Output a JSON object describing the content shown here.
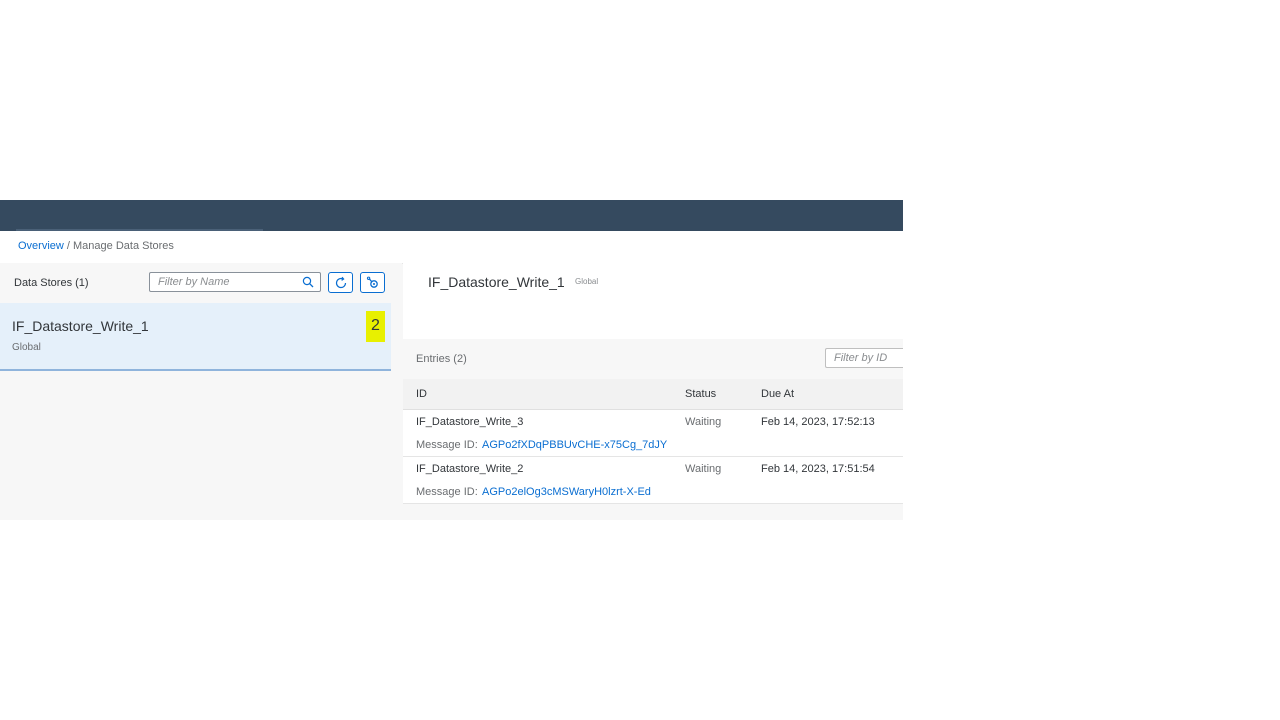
{
  "breadcrumb": {
    "link": "Overview",
    "separator": " / ",
    "current": "Manage Data Stores"
  },
  "master": {
    "title": "Data Stores (1)",
    "search_placeholder": "Filter by Name",
    "search_icon": "search-icon",
    "refresh_icon": "refresh-icon",
    "settings_icon": "gear-icon",
    "items": [
      {
        "name": "IF_Datastore_Write_1",
        "scope": "Global",
        "count": "2"
      }
    ]
  },
  "detail": {
    "title": "IF_Datastore_Write_1",
    "scope": "Global",
    "entries_title": "Entries (2)",
    "filter_placeholder": "Filter by ID",
    "columns": {
      "id": "ID",
      "status": "Status",
      "due": "Due At"
    },
    "message_label": "Message ID:",
    "rows": [
      {
        "id": "IF_Datastore_Write_3",
        "status": "Waiting",
        "due": "Feb 14, 2023, 17:52:13",
        "message_id": "AGPo2fXDqPBBUvCHE-x75Cg_7dJY"
      },
      {
        "id": "IF_Datastore_Write_2",
        "status": "Waiting",
        "due": "Feb 14, 2023, 17:51:54",
        "message_id": "AGPo2elOg3cMSWaryH0lzrt-X-Ed"
      }
    ]
  },
  "colors": {
    "shell": "#354a5f",
    "link": "#0a6ed1",
    "selected": "#e5f0fa",
    "highlight": "#e8f000"
  }
}
